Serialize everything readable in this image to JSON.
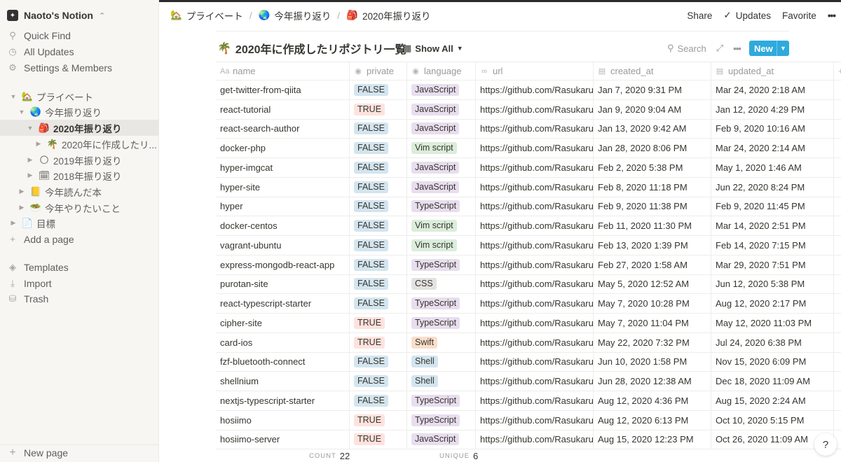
{
  "workspace": {
    "name": "Naoto's Notion"
  },
  "sidebar": {
    "quick_find": "Quick Find",
    "all_updates": "All Updates",
    "settings": "Settings & Members",
    "tree": [
      {
        "label": "プライベート",
        "emoji": "🏡",
        "toggle": "▼",
        "indent": 0
      },
      {
        "label": "今年振り返り",
        "emoji": "🌏",
        "toggle": "▼",
        "indent": 1
      },
      {
        "label": "2020年振り返り",
        "emoji": "🎒",
        "toggle": "▼",
        "indent": 2
      },
      {
        "label": "2020年に作成したリ...",
        "emoji": "🌴",
        "toggle": "▶",
        "indent": 3
      },
      {
        "label": "2019年振り返り",
        "emoji": "🌕",
        "toggle": "▶",
        "indent": 2
      },
      {
        "label": "2018年振り返り",
        "emoji": "🗓",
        "toggle": "▶",
        "indent": 2
      },
      {
        "label": "今年読んだ本",
        "emoji": "📒",
        "toggle": "▶",
        "indent": 1
      },
      {
        "label": "今年やりたいこと",
        "emoji": "🥗",
        "toggle": "▶",
        "indent": 1
      },
      {
        "label": "目標",
        "emoji": "📄",
        "toggle": "▶",
        "indent": 0
      }
    ],
    "add_page": "Add a page",
    "templates": "Templates",
    "import": "Import",
    "trash": "Trash",
    "new_page": "New page"
  },
  "breadcrumb": [
    {
      "label": "プライベート",
      "emoji": "🏡"
    },
    {
      "label": "今年振り返り",
      "emoji": "🌏"
    },
    {
      "label": "2020年振り返り",
      "emoji": "🎒"
    }
  ],
  "topbar": {
    "share": "Share",
    "updates": "Updates",
    "favorite": "Favorite",
    "more": "•••"
  },
  "database": {
    "emoji": "🌴",
    "title": "2020年に作成したリポジトリ一覧",
    "view": "Show All",
    "search": "Search",
    "new_button": "New",
    "columns": [
      "name",
      "private",
      "language",
      "url",
      "created_at",
      "updated_at"
    ],
    "rows": [
      {
        "name": "get-twitter-from-qiita",
        "private": "FALSE",
        "language": "JavaScript",
        "url": "https://github.com/Rasukarusan",
        "created_at": "Jan 7, 2020 9:31 PM",
        "updated_at": "Mar 24, 2020 2:18 AM"
      },
      {
        "name": "react-tutorial",
        "private": "TRUE",
        "language": "JavaScript",
        "url": "https://github.com/Rasukarusan",
        "created_at": "Jan 9, 2020 9:04 AM",
        "updated_at": "Jan 12, 2020 4:29 PM"
      },
      {
        "name": "react-search-author",
        "private": "FALSE",
        "language": "JavaScript",
        "url": "https://github.com/Rasukarusan",
        "created_at": "Jan 13, 2020 9:42 AM",
        "updated_at": "Feb 9, 2020 10:16 AM"
      },
      {
        "name": "docker-php",
        "private": "FALSE",
        "language": "Vim script",
        "url": "https://github.com/Rasukarusan",
        "created_at": "Jan 28, 2020 8:06 PM",
        "updated_at": "Mar 24, 2020 2:14 AM"
      },
      {
        "name": "hyper-imgcat",
        "private": "FALSE",
        "language": "JavaScript",
        "url": "https://github.com/Rasukarusan",
        "created_at": "Feb 2, 2020 5:38 PM",
        "updated_at": "May 1, 2020 1:46 AM"
      },
      {
        "name": "hyper-site",
        "private": "FALSE",
        "language": "JavaScript",
        "url": "https://github.com/Rasukarusan",
        "created_at": "Feb 8, 2020 11:18 PM",
        "updated_at": "Jun 22, 2020 8:24 PM"
      },
      {
        "name": "hyper",
        "private": "FALSE",
        "language": "TypeScript",
        "url": "https://github.com/Rasukarusan",
        "created_at": "Feb 9, 2020 11:38 PM",
        "updated_at": "Feb 9, 2020 11:45 PM"
      },
      {
        "name": "docker-centos",
        "private": "FALSE",
        "language": "Vim script",
        "url": "https://github.com/Rasukarusan",
        "created_at": "Feb 11, 2020 11:30 PM",
        "updated_at": "Mar 14, 2020 2:51 PM"
      },
      {
        "name": "vagrant-ubuntu",
        "private": "FALSE",
        "language": "Vim script",
        "url": "https://github.com/Rasukarusan",
        "created_at": "Feb 13, 2020 1:39 PM",
        "updated_at": "Feb 14, 2020 7:15 PM"
      },
      {
        "name": "express-mongodb-react-app",
        "private": "FALSE",
        "language": "TypeScript",
        "url": "https://github.com/Rasukarusan",
        "created_at": "Feb 27, 2020 1:58 AM",
        "updated_at": "Mar 29, 2020 7:51 PM"
      },
      {
        "name": "purotan-site",
        "private": "FALSE",
        "language": "CSS",
        "url": "https://github.com/Rasukarusan",
        "created_at": "May 5, 2020 12:52 AM",
        "updated_at": "Jun 12, 2020 5:38 PM"
      },
      {
        "name": "react-typescript-starter",
        "private": "FALSE",
        "language": "TypeScript",
        "url": "https://github.com/Rasukarusan",
        "created_at": "May 7, 2020 10:28 PM",
        "updated_at": "Aug 12, 2020 2:17 PM"
      },
      {
        "name": "cipher-site",
        "private": "TRUE",
        "language": "TypeScript",
        "url": "https://github.com/Rasukarusan",
        "created_at": "May 7, 2020 11:04 PM",
        "updated_at": "May 12, 2020 11:03 PM"
      },
      {
        "name": "card-ios",
        "private": "TRUE",
        "language": "Swift",
        "url": "https://github.com/Rasukarusan",
        "created_at": "May 22, 2020 7:32 PM",
        "updated_at": "Jul 24, 2020 6:38 PM"
      },
      {
        "name": "fzf-bluetooth-connect",
        "private": "FALSE",
        "language": "Shell",
        "url": "https://github.com/Rasukarusan",
        "created_at": "Jun 10, 2020 1:58 PM",
        "updated_at": "Nov 15, 2020 6:09 PM"
      },
      {
        "name": "shellnium",
        "private": "FALSE",
        "language": "Shell",
        "url": "https://github.com/Rasukarusan",
        "created_at": "Jun 28, 2020 12:38 AM",
        "updated_at": "Dec 18, 2020 11:09 AM"
      },
      {
        "name": "nextjs-typescript-starter",
        "private": "FALSE",
        "language": "TypeScript",
        "url": "https://github.com/Rasukarusan",
        "created_at": "Aug 12, 2020 4:36 PM",
        "updated_at": "Aug 15, 2020 2:24 AM"
      },
      {
        "name": "hosiimo",
        "private": "TRUE",
        "language": "TypeScript",
        "url": "https://github.com/Rasukarusan",
        "created_at": "Aug 12, 2020 6:13 PM",
        "updated_at": "Oct 10, 2020 5:15 PM"
      },
      {
        "name": "hosiimo-server",
        "private": "TRUE",
        "language": "JavaScript",
        "url": "https://github.com/Rasukarusan",
        "created_at": "Aug 15, 2020 12:23 PM",
        "updated_at": "Oct 26, 2020 11:09 AM"
      }
    ],
    "footer": {
      "count_label": "COUNT",
      "count_value": "22",
      "unique_label": "UNIQUE",
      "unique_value": "6"
    }
  },
  "help": "?"
}
